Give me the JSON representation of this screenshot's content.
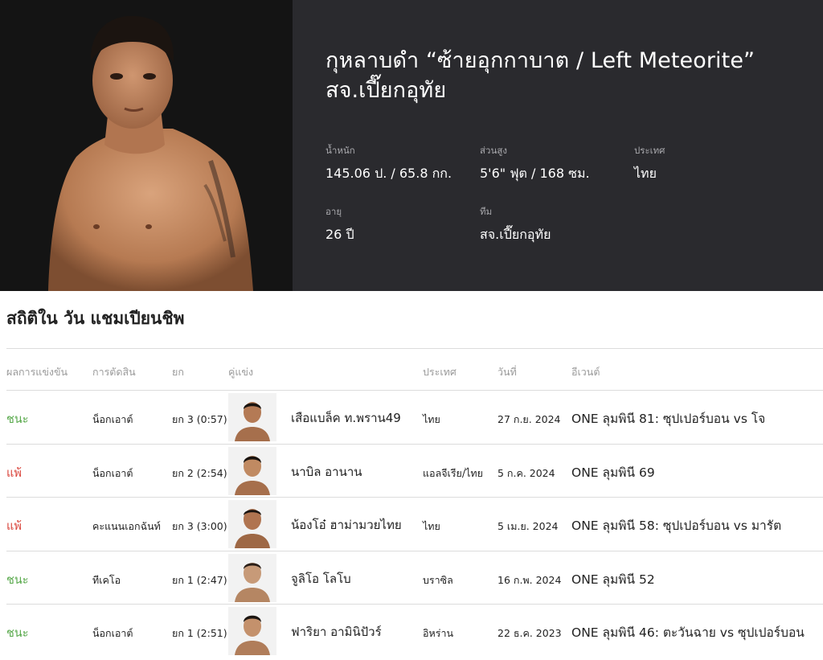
{
  "fighter": {
    "name": "กุหลาบดำ “ซ้ายอุกกาบาต / Left Meteorite” สจ.เปี๊ยกอุทัย",
    "stats": {
      "weight_label": "น้ำหนัก",
      "weight_value": "145.06 ป. / 65.8 กก.",
      "height_label": "ส่วนสูง",
      "height_value": "5'6\" ฟุต / 168 ซม.",
      "country_label": "ประเทศ",
      "country_value": "ไทย",
      "age_label": "อายุ",
      "age_value": "26 ปี",
      "team_label": "ทีม",
      "team_value": "สจ.เปี๊ยกอุทัย"
    }
  },
  "section_title": "สถิติใน วัน แชมเปียนชิพ",
  "table": {
    "headers": {
      "result": "ผลการแข่งขัน",
      "method": "การตัดสิน",
      "round": "ยก",
      "opponent": "คู่แข่ง",
      "country": "ประเทศ",
      "date": "วันที่",
      "event": "อีเวนต์"
    },
    "rows": [
      {
        "result": "ชนะ",
        "outcome": "win",
        "method": "น็อกเอาต์",
        "round": "ยก 3 (0:57)",
        "opponent": "เสือแบล็ค ท.พราน49",
        "country": "ไทย",
        "date": "27 ก.ย. 2024",
        "event": "ONE ลุมพินี 81: ซุปเปอร์บอน vs โจ"
      },
      {
        "result": "แพ้",
        "outcome": "loss",
        "method": "น็อกเอาต์",
        "round": "ยก 2 (2:54)",
        "opponent": "นาบิล อานาน",
        "country": "แอลจีเรีย/ไทย",
        "date": "5 ก.ค. 2024",
        "event": "ONE ลุมพินี 69"
      },
      {
        "result": "แพ้",
        "outcome": "loss",
        "method": "คะแนนเอกฉันท์",
        "round": "ยก 3 (3:00)",
        "opponent": "น้องโอ๋ ฮาม่ามวยไทย",
        "country": "ไทย",
        "date": "5 เม.ย. 2024",
        "event": "ONE ลุมพินี 58: ซุปเปอร์บอน vs มารัต"
      },
      {
        "result": "ชนะ",
        "outcome": "win",
        "method": "ทีเคโอ",
        "round": "ยก 1 (2:47)",
        "opponent": "จูลิโอ โลโบ",
        "country": "บราซิล",
        "date": "16 ก.พ. 2024",
        "event": "ONE ลุมพินี 52"
      },
      {
        "result": "ชนะ",
        "outcome": "win",
        "method": "น็อกเอาต์",
        "round": "ยก 1 (2:51)",
        "opponent": "ฟาริยา อามินิปัวร์",
        "country": "อิหร่าน",
        "date": "22 ธ.ค. 2023",
        "event": "ONE ลุมพินี 46: ตะวันฉาย vs ซุปเปอร์บอน"
      }
    ]
  },
  "colors": {
    "win": "#57a84a",
    "loss": "#d9433a",
    "hero_dark": "#2a2a2e"
  }
}
